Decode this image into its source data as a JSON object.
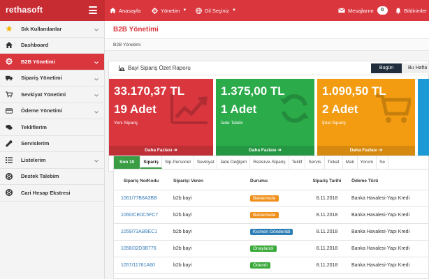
{
  "brand": "rethasoft",
  "topnav": {
    "home": "Anasayfa",
    "admin": "Yönetim",
    "language": "Dil Seçiniz",
    "messages": "Mesajlarım",
    "messages_count": "0",
    "notifications": "Bildirimler"
  },
  "sidebar": {
    "items": [
      {
        "label": "Sık Kullanılanlar",
        "icon": "star-icon"
      },
      {
        "label": "Dashboard",
        "icon": "home-icon"
      },
      {
        "label": "B2B Yönetimi",
        "icon": "gear-icon"
      },
      {
        "label": "Sipariş Yönetimi",
        "icon": "truck-icon"
      },
      {
        "label": "Sevkiyat Yönetimi",
        "icon": "cart-icon"
      },
      {
        "label": "Ödeme Yönetimi",
        "icon": "card-icon"
      },
      {
        "label": "Tekliflerim",
        "icon": "chat-icon"
      },
      {
        "label": "Servislerim",
        "icon": "wrench-icon"
      },
      {
        "label": "Listelerim",
        "icon": "list-icon"
      },
      {
        "label": "Destek Talebim",
        "icon": "lifebuoy-icon"
      },
      {
        "label": "Cari Hesap Ekstresi",
        "icon": "lifebuoy-icon"
      }
    ]
  },
  "page": {
    "title": "B2B Yönetimi",
    "breadcrumb": "B2B Yönetimi"
  },
  "report": {
    "title": "Bayi Sipariş Özet Raporu",
    "tab_today": "Bugün",
    "tab_week": "Bu Hafta",
    "cards": [
      {
        "amount": "33.170,37 TL",
        "count": "19 Adet",
        "label": "Yeni Sipariş",
        "more": "Daha Fazlası",
        "color": "#d9363e"
      },
      {
        "amount": "1.375,00 TL",
        "count": "1 Adet",
        "label": "İade Talebi",
        "more": "Daha Fazlası",
        "color": "#2bab4a"
      },
      {
        "amount": "1.090,50 TL",
        "count": "2 Adet",
        "label": "İptal Sipariş",
        "more": "Daha Fazlası",
        "color": "#f39c11"
      }
    ]
  },
  "orders": {
    "tabs": [
      "Son 10",
      "Sipariş",
      "Sip.Personel",
      "Sevkiyat",
      "İade Değişim",
      "Rezerve-Sipariş",
      "Teklif",
      "Servis",
      "Ticket",
      "Mail",
      "Yorum",
      "Se"
    ],
    "headers": {
      "code": "Sipariş No/Kodu",
      "giver": "Siparişi Veren",
      "status": "Durumu",
      "date": "Sipariş Tarihi",
      "payment": "Ödeme Türü"
    },
    "rows": [
      {
        "code": "1061/77B8A3BB",
        "giver": "b2b bayi",
        "status": "Beklemede",
        "status_color": "#f0901c",
        "date": "8.11.2018",
        "payment": "Banka Havalesi-Yapı Kredi"
      },
      {
        "code": "1060/CE0C5FC7",
        "giver": "b2b bayi",
        "status": "Beklemede",
        "status_color": "#f0901c",
        "date": "8.11.2018",
        "payment": "Banka Havalesi-Yapı Kredi"
      },
      {
        "code": "1059/73AB9EC1",
        "giver": "b2b bayi",
        "status": "Kısmen Gönderildi",
        "status_color": "#2d7fb6",
        "date": "8.11.2018",
        "payment": "Banka Havalesi-Yapı Kredi"
      },
      {
        "code": "1058/32D3B776",
        "giver": "b2b bayi",
        "status": "Onaylandı",
        "status_color": "#3aaa3a",
        "date": "8.11.2018",
        "payment": "Banka Havalesi-Yapı Kredi"
      },
      {
        "code": "1057/11761A60",
        "giver": "b2b bayi",
        "status": "Ödendi",
        "status_color": "#3aaa3a",
        "date": "8.11.2018",
        "payment": "Banka Havalesi-Yapı Kredi"
      }
    ]
  }
}
